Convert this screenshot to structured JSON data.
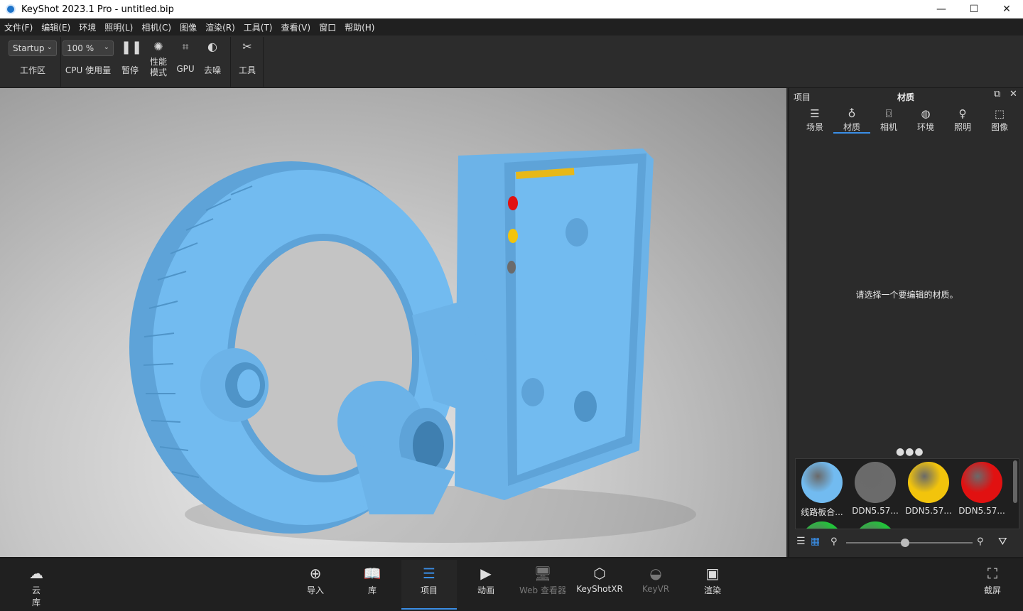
{
  "window": {
    "title": "KeyShot 2023.1 Pro  - untitled.bip",
    "minimize": "—",
    "maximize": "☐",
    "close": "✕"
  },
  "menu": [
    "文件(F)",
    "编辑(E)",
    "环境",
    "照明(L)",
    "相机(C)",
    "图像",
    "渲染(R)",
    "工具(T)",
    "查看(V)",
    "窗口",
    "帮助(H)"
  ],
  "toolbar": {
    "workspace_value": "Startup",
    "workspace_label": "工作区",
    "cpu_value": "100 %",
    "cpu_label": "CPU 使用量",
    "pause_label": "暂停",
    "perf_label_1": "性能",
    "perf_label_2": "模式",
    "gpu_label": "GPU",
    "denoise_label": "去噪",
    "tools_label": "工具"
  },
  "panel": {
    "left_title": "项目",
    "title": "材质",
    "tabs": [
      {
        "label": "场景",
        "icon": "list-icon"
      },
      {
        "label": "材质",
        "icon": "material-icon"
      },
      {
        "label": "相机",
        "icon": "camera-icon"
      },
      {
        "label": "环境",
        "icon": "globe-icon"
      },
      {
        "label": "照明",
        "icon": "bulb-icon"
      },
      {
        "label": "图像",
        "icon": "image-frame-icon"
      }
    ],
    "active_tab": "材质",
    "empty_message": "请选择一个要编辑的材质。",
    "more": "●●●",
    "swatches": [
      {
        "name": "线路板合...",
        "color": "#72bbf0"
      },
      {
        "name": "DDN5.57...",
        "color": "#6b6b6b"
      },
      {
        "name": "DDN5.57...",
        "color": "#f2c40c"
      },
      {
        "name": "DDN5.57...",
        "color": "#e11111"
      },
      {
        "name": "",
        "color": "#22c33a"
      },
      {
        "name": "",
        "color": "#22c33a"
      }
    ],
    "zoom_slider": 0.43
  },
  "bottombar": {
    "cloud_label_1": "云",
    "cloud_label_2": "库",
    "import_label": "导入",
    "library_label": "库",
    "project_label": "项目",
    "animation_label": "动画",
    "web_viewer_label": "Web 查看器",
    "keyshotxr_label": "KeyShotXR",
    "keyvr_label": "KeyVR",
    "render_label": "渲染",
    "screenshot_label": "截屏"
  },
  "colors": {
    "accent": "#3a8ee6",
    "model": "#72bbf0",
    "model_shadow": "#4f94c8"
  }
}
